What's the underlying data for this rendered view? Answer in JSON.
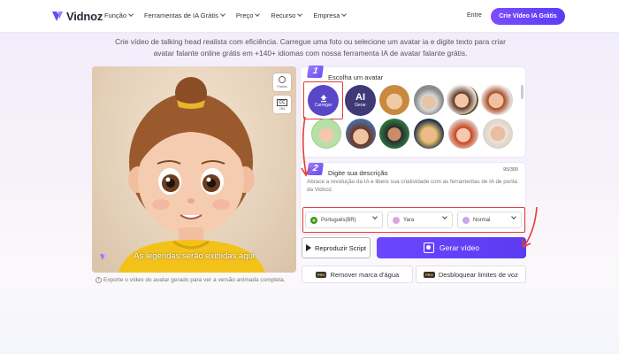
{
  "nav": {
    "brand": "Vidnoz",
    "menu": [
      "Função",
      "Ferramentas de IA Grátis",
      "Preço",
      "Recurso",
      "Empresa"
    ],
    "login": "Entre",
    "cta": "Crie Vídeo IA Grátis"
  },
  "hero": {
    "subtitle_line1": "Crie vídeo de talking head realista com eficiência. Carregue uma foto ou selecione um avatar ia e digite texto para criar",
    "subtitle_line2": "avatar falante online grátis em +140+ idiomas com nossa ferramenta IA de avatar falante grátis."
  },
  "preview": {
    "tools": {
      "background": "Fundo",
      "cc": "CC",
      "cc_state": "ON"
    },
    "caption": "As legendas serão exibidas aqui",
    "note": "Exporte o vídeo do avatar gerado para ver a versão animada completa."
  },
  "step1": {
    "number": "1",
    "title": "Escolha um avatar",
    "upload_label": "Carregar",
    "ai_big": "AI",
    "ai_label": "Gerar",
    "avatars": [
      "girl-blonde",
      "einstein",
      "mona-lisa",
      "old-man",
      "girl-cartoon",
      "woman-red",
      "boy-cartoon-green",
      "boy-cartoon",
      "ronaldo",
      "trump",
      "girl-red-hair",
      "man-bald"
    ]
  },
  "step2": {
    "number": "2",
    "title": "Digite sua descrição",
    "counter": "95/300",
    "text": "Abrace a revolução da IA e libere sua criatividade com as ferramentas de IA de ponta da Vidnoz.",
    "language": "Português(BR)",
    "voice": "Yara",
    "speed": "Normal"
  },
  "actions": {
    "play_script": "Reproduzir Script",
    "generate": "Gerar vídeo",
    "pro_badge": "PRO",
    "remove_watermark": "Remover marca d'água",
    "unlock_limits": "Desbloquear limites de voz"
  },
  "colors": {
    "accent": "#5a3cf0",
    "highlight": "#e53b3b"
  }
}
